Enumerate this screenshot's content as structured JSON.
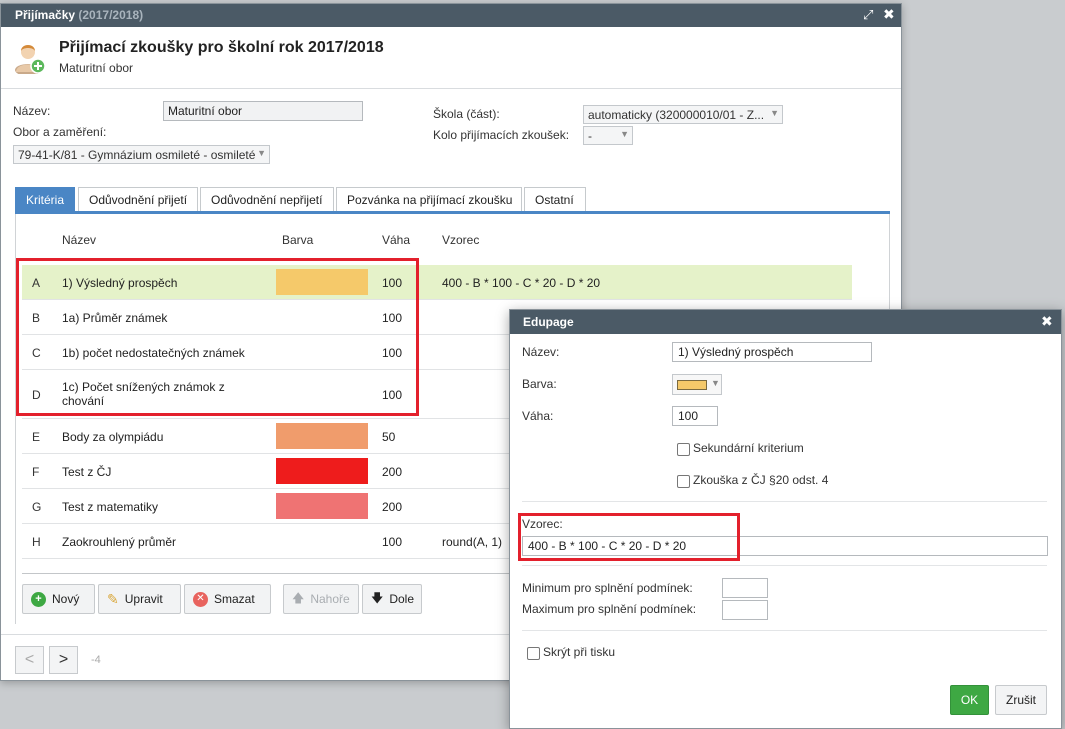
{
  "main_window": {
    "title": "Přijímačky",
    "title_year": "(2017/2018)",
    "header": {
      "title": "Přijímací zkoušky pro školní rok 2017/2018",
      "subtitle": "Maturitní obor"
    },
    "form": {
      "name_label": "Název:",
      "name_value": "Maturitní obor",
      "field_label": "Obor a zaměření:",
      "field_value": "79-41-K/81 - Gymnázium osmileté - osmileté",
      "school_label": "Škola (část):",
      "school_value": "automaticky (320000010/01 - Z...",
      "round_label": "Kolo přijímacích zkoušek:",
      "round_value": "-"
    },
    "tabs": [
      {
        "label": "Kritéria"
      },
      {
        "label": "Odůvodnění přijetí"
      },
      {
        "label": "Odůvodnění nepřijetí"
      },
      {
        "label": "Pozvánka na přijímací zkoušku"
      },
      {
        "label": "Ostatní"
      }
    ],
    "table": {
      "headers": {
        "name": "Název",
        "color": "Barva",
        "weight": "Váha",
        "formula": "Vzorec"
      },
      "rows": [
        {
          "letter": "A",
          "name": "1) Výsledný prospěch",
          "color": "#f5c96a",
          "weight": "100",
          "formula": "400 - B * 100 - C * 20 - D * 20"
        },
        {
          "letter": "B",
          "name": "1a) Průměr známek",
          "color": "",
          "weight": "100",
          "formula": ""
        },
        {
          "letter": "C",
          "name": "1b) počet nedostatečných známek",
          "color": "",
          "weight": "100",
          "formula": ""
        },
        {
          "letter": "D",
          "name": "1c) Počet snížených známok z chování",
          "color": "",
          "weight": "100",
          "formula": ""
        },
        {
          "letter": "E",
          "name": "Body za olympiádu",
          "color": "#f09c6c",
          "weight": "50",
          "formula": ""
        },
        {
          "letter": "F",
          "name": "Test z ČJ",
          "color": "#ee1c1c",
          "weight": "200",
          "formula": ""
        },
        {
          "letter": "G",
          "name": "Test z matematiky",
          "color": "#ef7373",
          "weight": "200",
          "formula": ""
        },
        {
          "letter": "H",
          "name": "Zaokrouhlený průměr",
          "color": "",
          "weight": "100",
          "formula": "round(A, 1)"
        }
      ]
    },
    "toolbar": {
      "new_label": "Nový",
      "edit_label": "Upravit",
      "delete_label": "Smazat",
      "up_label": "Nahoře",
      "down_label": "Dole"
    },
    "pager": {
      "prev": "<",
      "next": ">",
      "info": "-4"
    }
  },
  "dialog": {
    "title": "Edupage",
    "name_label": "Název:",
    "name_value": "1) Výsledný prospěch",
    "color_label": "Barva:",
    "color_value": "#f5c96a",
    "weight_label": "Váha:",
    "weight_value": "100",
    "secondary_label": "Sekundární kriterium",
    "cj_label": "Zkouška z ČJ §20 odst. 4",
    "formula_label": "Vzorec:",
    "formula_value": "400 - B * 100 - C * 20 - D * 20",
    "min_label": "Minimum pro splnění podmínek:",
    "max_label": "Maximum pro splnění podmínek:",
    "hide_label": "Skrýt při tisku",
    "ok_label": "OK",
    "cancel_label": "Zrušit"
  },
  "accent_colors": {
    "titlebar": "#4b5a66",
    "tab_active": "#4a86c5",
    "selected_row": "#e5f2c9",
    "highlight_box": "#e3202c",
    "ok_button": "#3ea843"
  }
}
